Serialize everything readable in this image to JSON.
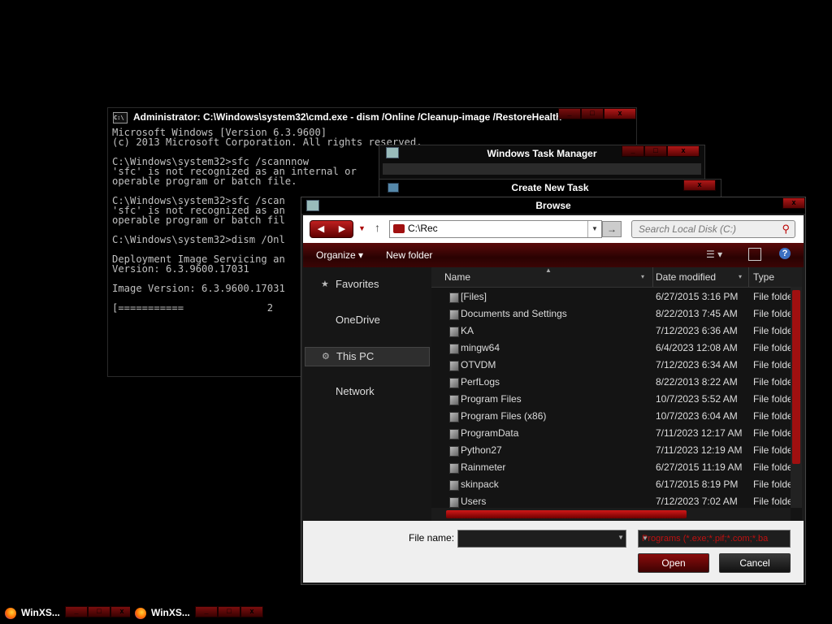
{
  "cmd": {
    "title": "Administrator: C:\\Windows\\system32\\cmd.exe - dism  /Online /Cleanup-image /RestoreHealth",
    "lines": "Microsoft Windows [Version 6.3.9600]\n(c) 2013 Microsoft Corporation. All rights reserved.\n\nC:\\Windows\\system32>sfc /scannnow\n'sfc' is not recognized as an internal or\noperable program or batch file.\n\nC:\\Windows\\system32>sfc /scan\n'sfc' is not recognized as an\noperable program or batch fil\n\nC:\\Windows\\system32>dism /Onl\n\nDeployment Image Servicing an\nVersion: 6.3.9600.17031\n\nImage Version: 6.3.9600.17031\n\n[===========              2"
  },
  "task_manager": {
    "title": "Windows Task Manager"
  },
  "create_task": {
    "title": "Create New Task"
  },
  "browse": {
    "title": "Browse",
    "address": "C:\\Rec",
    "search_placeholder": "Search Local Disk (C:)",
    "organize_label": "Organize ▾",
    "new_folder_label": "New folder",
    "nav": {
      "favorites": "Favorites",
      "onedrive": "OneDrive",
      "this_pc": "This PC",
      "network": "Network"
    },
    "columns": {
      "name": "Name",
      "date": "Date modified",
      "type": "Type"
    },
    "files": [
      {
        "name": "[Files]",
        "date": "6/27/2015 3:16 PM",
        "type": "File folder"
      },
      {
        "name": "Documents and Settings",
        "date": "8/22/2013 7:45 AM",
        "type": "File folder"
      },
      {
        "name": "KA",
        "date": "7/12/2023 6:36 AM",
        "type": "File folder"
      },
      {
        "name": "mingw64",
        "date": "6/4/2023 12:08 AM",
        "type": "File folder"
      },
      {
        "name": "OTVDM",
        "date": "7/12/2023 6:34 AM",
        "type": "File folder"
      },
      {
        "name": "PerfLogs",
        "date": "8/22/2013 8:22 AM",
        "type": "File folder"
      },
      {
        "name": "Program Files",
        "date": "10/7/2023 5:52 AM",
        "type": "File folder"
      },
      {
        "name": "Program Files (x86)",
        "date": "10/7/2023 6:04 AM",
        "type": "File folder"
      },
      {
        "name": "ProgramData",
        "date": "7/11/2023 12:17 AM",
        "type": "File folder"
      },
      {
        "name": "Python27",
        "date": "7/11/2023 12:19 AM",
        "type": "File folder"
      },
      {
        "name": "Rainmeter",
        "date": "6/27/2015 11:19 AM",
        "type": "File folder"
      },
      {
        "name": "skinpack",
        "date": "6/17/2015 8:19 PM",
        "type": "File folder"
      },
      {
        "name": "Users",
        "date": "7/12/2023 7:02 AM",
        "type": "File folder"
      }
    ],
    "file_name_label": "File name:",
    "file_name_value": "",
    "filter": "Programs (*.exe;*.pif;*.com;*.ba",
    "open_label": "Open",
    "cancel_label": "Cancel"
  },
  "taskbar": [
    {
      "label": "WinXS..."
    },
    {
      "label": "WinXS..."
    }
  ],
  "colors": {
    "accent": "#a01010",
    "background": "#000000"
  }
}
